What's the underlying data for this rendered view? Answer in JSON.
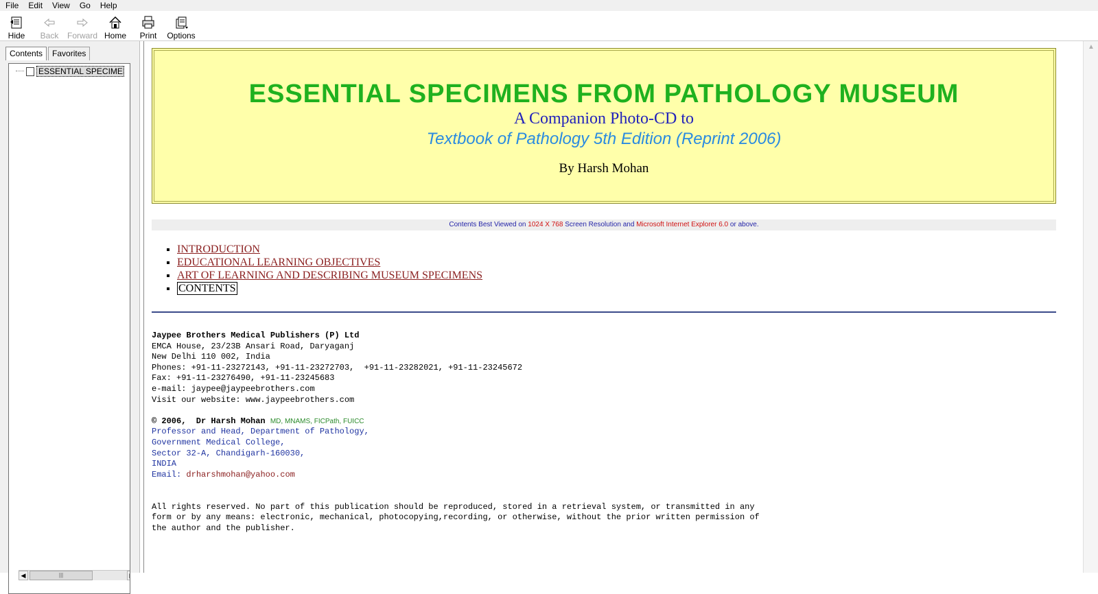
{
  "menu": [
    "File",
    "Edit",
    "View",
    "Go",
    "Help"
  ],
  "toolbar": {
    "hide": "Hide",
    "back": "Back",
    "forward": "Forward",
    "home": "Home",
    "print": "Print",
    "options": "Options"
  },
  "left": {
    "tabs": [
      "Contents",
      "Favorites"
    ],
    "tree_item": "ESSENTIAL SPECIMENS F"
  },
  "banner": {
    "title": "ESSENTIAL SPECIMENS FROM PATHOLOGY MUSEUM",
    "sub1": "A Companion Photo-CD to",
    "sub2": "Textbook of Pathology 5th Edition (Reprint 2006)",
    "author": "By Harsh Mohan"
  },
  "notice": {
    "p1": "Contents Best Viewed on ",
    "res": "1024 X 768",
    "p2": " Screen Resolution and ",
    "browser": "Microsoft Internet Explorer 6.0",
    "p3": " or above."
  },
  "nav": [
    "INTRODUCTION",
    "EDUCATIONAL LEARNING OBJECTIVES",
    "ART OF LEARNING AND DESCRIBING MUSEUM SPECIMENS",
    "CONTENTS"
  ],
  "publisher": {
    "name": "Jaypee Brothers Medical Publishers (P) Ltd",
    "addr1": "EMCA House, 23/23B Ansari Road, Daryaganj",
    "addr2": "New Delhi 110 002, India",
    "phones": "Phones: +91-11-23272143, +91-11-23272703,  +91-11-23282021, +91-11-23245672",
    "fax": "Fax: +91-11-23276490, +91-11-23245683",
    "email": "e-mail: jaypee@jaypeebrothers.com",
    "website": "Visit our website: www.jaypeebrothers.com"
  },
  "author": {
    "copy": "© 2006,  Dr Harsh Mohan",
    "degrees": "MD, MNAMS, FICPath, FUICC",
    "line1": "Professor and Head, Department of Pathology,",
    "line2": "Government Medical College,",
    "line3": "Sector 32-A, Chandigarh-160030,",
    "line4": "INDIA",
    "email_label": "Email: ",
    "email": "drharshmohan@yahoo.com"
  },
  "rights": {
    "l1": "All rights reserved. No part of this publication should be reproduced, stored in a retrieval system, or transmitted in any",
    "l2": "form or by any means: electronic, mechanical, photocopying,recording, or otherwise, without the prior written permission of",
    "l3": "the author and the publisher."
  }
}
